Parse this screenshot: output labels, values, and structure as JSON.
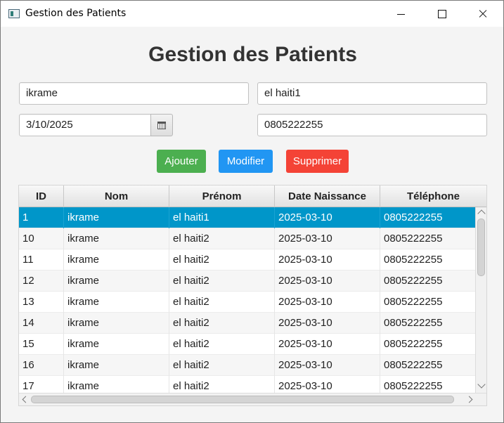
{
  "window": {
    "title": "Gestion des Patients"
  },
  "heading": "Gestion des Patients",
  "form": {
    "nom": "ikrame",
    "prenom": "el haiti1",
    "date_naissance": "3/10/2025",
    "telephone": "0805222255"
  },
  "buttons": {
    "add": "Ajouter",
    "edit": "Modifier",
    "delete": "Supprimer"
  },
  "colors": {
    "add": "#4caf50",
    "edit": "#2196f3",
    "delete": "#f44336",
    "selection": "#0096c9"
  },
  "table": {
    "columns": [
      "ID",
      "Nom",
      "Prénom",
      "Date Naissance",
      "Téléphone"
    ],
    "selected_index": 0,
    "rows": [
      [
        "1",
        "ikrame",
        "el haiti1",
        "2025-03-10",
        "0805222255"
      ],
      [
        "10",
        "ikrame",
        "el haiti2",
        "2025-03-10",
        "0805222255"
      ],
      [
        "11",
        "ikrame",
        "el haiti2",
        "2025-03-10",
        "0805222255"
      ],
      [
        "12",
        "ikrame",
        "el haiti2",
        "2025-03-10",
        "0805222255"
      ],
      [
        "13",
        "ikrame",
        "el haiti2",
        "2025-03-10",
        "0805222255"
      ],
      [
        "14",
        "ikrame",
        "el haiti2",
        "2025-03-10",
        "0805222255"
      ],
      [
        "15",
        "ikrame",
        "el haiti2",
        "2025-03-10",
        "0805222255"
      ],
      [
        "16",
        "ikrame",
        "el haiti2",
        "2025-03-10",
        "0805222255"
      ],
      [
        "17",
        "ikrame",
        "el haiti2",
        "2025-03-10",
        "0805222255"
      ]
    ]
  }
}
